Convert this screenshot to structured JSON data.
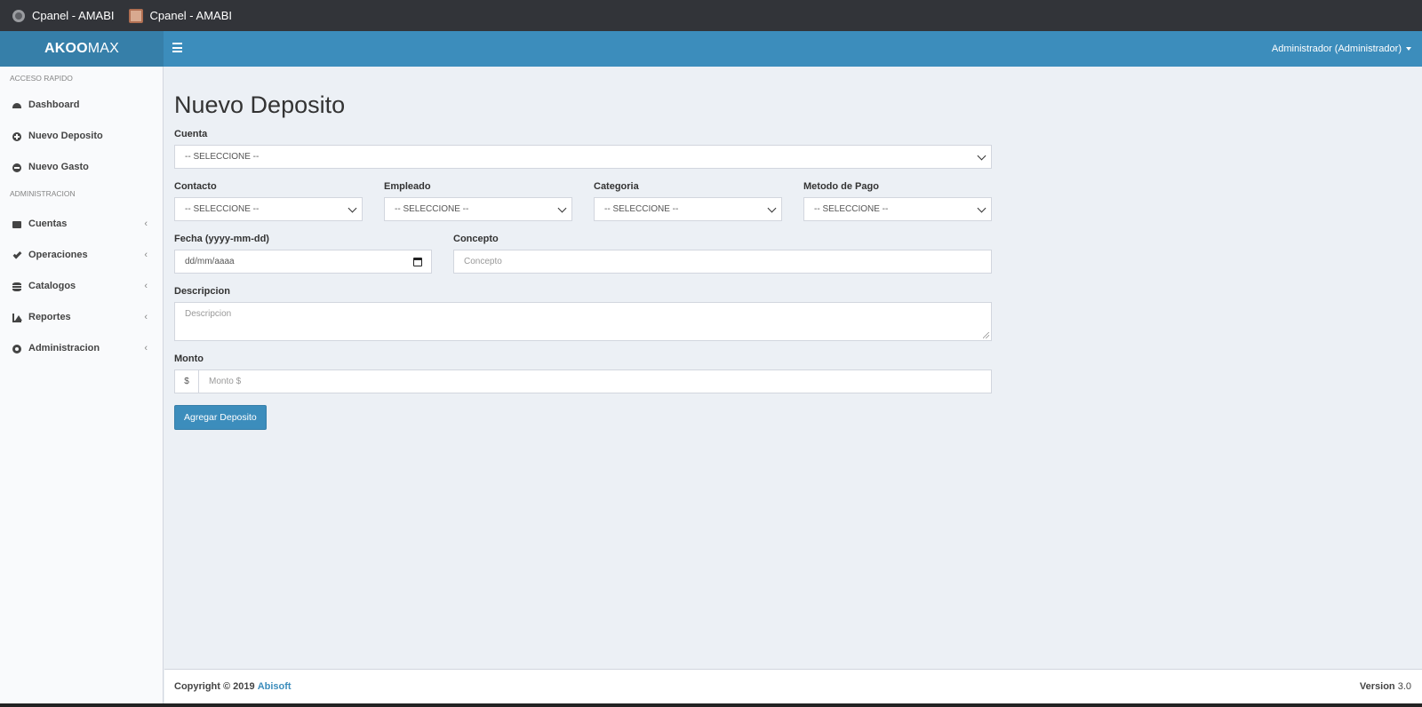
{
  "browser": {
    "tabs": [
      {
        "label": "Cpanel - AMABI",
        "icon": "globe-icon"
      },
      {
        "label": "Cpanel - AMABI",
        "icon": "favicon-photo-icon"
      }
    ]
  },
  "header": {
    "logo_bold": "AKOO",
    "logo_light": "MAX",
    "user": "Administrador (Administrador)",
    "color": "#3c8dbc"
  },
  "sidebar": {
    "quick_header": "ACCESO RAPIDO",
    "quick_items": [
      {
        "label": "Dashboard",
        "icon": "dashboard-icon"
      },
      {
        "label": "Nuevo Deposito",
        "icon": "plus-circle-icon"
      },
      {
        "label": "Nuevo Gasto",
        "icon": "minus-circle-icon"
      }
    ],
    "admin_header": "ADMINISTRACION",
    "admin_items": [
      {
        "label": "Cuentas",
        "icon": "briefcase-icon"
      },
      {
        "label": "Operaciones",
        "icon": "check-icon"
      },
      {
        "label": "Catalogos",
        "icon": "database-icon"
      },
      {
        "label": "Reportes",
        "icon": "area-chart-icon"
      },
      {
        "label": "Administracion",
        "icon": "gear-icon"
      }
    ],
    "chevron": "‹"
  },
  "form": {
    "title": "Nuevo Deposito",
    "cuenta": {
      "label": "Cuenta",
      "value": "-- SELECCIONE --"
    },
    "contacto": {
      "label": "Contacto",
      "value": "-- SELECCIONE --"
    },
    "empleado": {
      "label": "Empleado",
      "value": "-- SELECCIONE --"
    },
    "categoria": {
      "label": "Categoria",
      "value": "-- SELECCIONE --"
    },
    "metodo": {
      "label": "Metodo de Pago",
      "value": "-- SELECCIONE --"
    },
    "fecha": {
      "label": "Fecha (yyyy-mm-dd)",
      "placeholder": "dd/mm/aaaa"
    },
    "concepto": {
      "label": "Concepto",
      "placeholder": "Concepto"
    },
    "descripcion": {
      "label": "Descripcion",
      "placeholder": "Descripcion"
    },
    "monto": {
      "label": "Monto",
      "addon": "$",
      "placeholder": "Monto $"
    },
    "submit": "Agregar Deposito"
  },
  "footer": {
    "copyright": "Copyright © 2019",
    "company": "Abisoft",
    "version_label": "Version",
    "version": "3.0"
  }
}
